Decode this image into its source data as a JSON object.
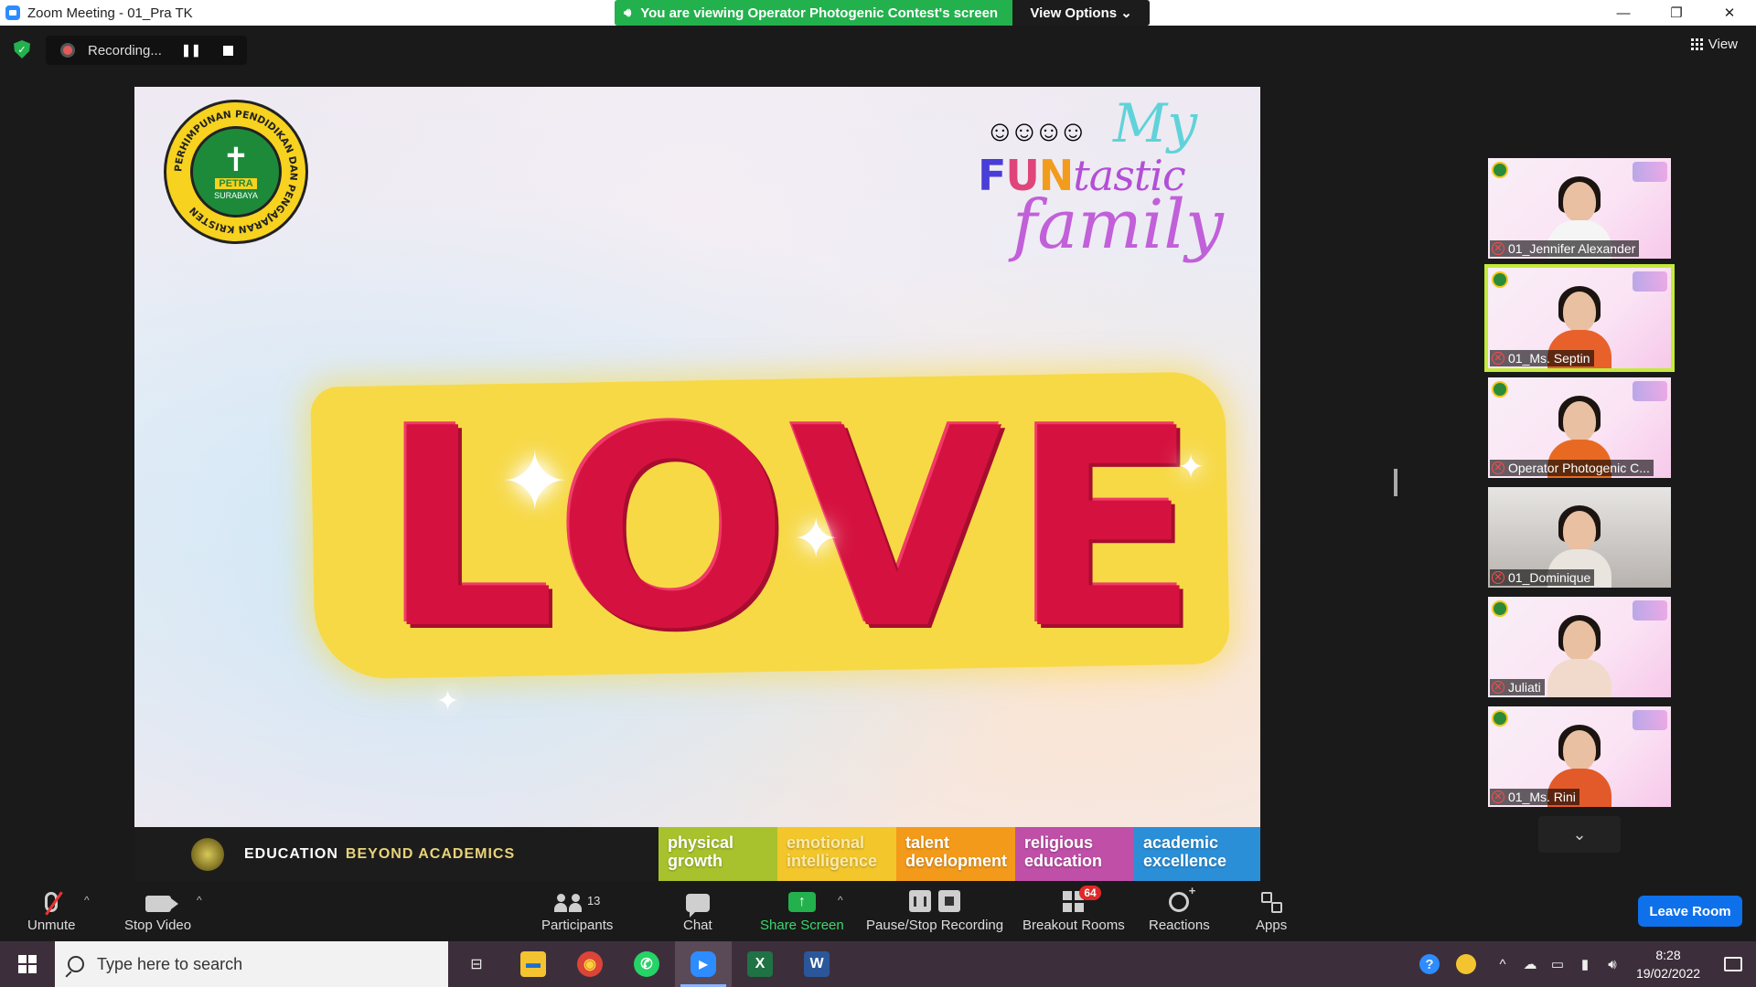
{
  "window": {
    "title": "Zoom Meeting - 01_Pra TK",
    "minimize": "—",
    "restore": "❐",
    "close": "✕"
  },
  "share_banner": {
    "viewing_text": "You are viewing Operator Photogenic Contest's screen",
    "view_options": "View Options ⌄"
  },
  "recording": {
    "status": "Recording...",
    "pause_glyph": "❚❚"
  },
  "view_button": {
    "label": "View"
  },
  "shared_slide": {
    "seal": {
      "name": "PETRA",
      "city": "SURABAYA",
      "ring_text": "PERHIMPUNAN PENDIDIKAN DAN PENGAJARAN KRISTEN"
    },
    "logo": {
      "my": "My",
      "fun": [
        "F",
        "U",
        "N"
      ],
      "tastic": "tastic",
      "family": "family"
    },
    "main_word": "LOVE",
    "footer": {
      "edu_part1": "EDUCATION",
      "edu_part2": "BEYOND ACADEMICS",
      "tiles": [
        {
          "line1": "physical",
          "line2": "growth",
          "color": "#a7c22c"
        },
        {
          "line1": "emotional",
          "line2": "intelligence",
          "color": "#f3c62b"
        },
        {
          "line1": "talent",
          "line2": "development",
          "color": "#f39a1b"
        },
        {
          "line1": "religious",
          "line2": "education",
          "color": "#c04fa8"
        },
        {
          "line1": "academic",
          "line2": "excellence",
          "color": "#2b8fd8"
        }
      ]
    }
  },
  "participants": [
    {
      "name": "01_Jennifer Alexander",
      "type": "slide",
      "body_color": "#f5f5f5",
      "active": false
    },
    {
      "name": "01_Ms. Septin",
      "type": "slide",
      "body_color": "#e8612b",
      "active": true
    },
    {
      "name": "Operator Photogenic C...",
      "type": "slide",
      "body_color": "#e86a22",
      "active": false
    },
    {
      "name": "01_Dominique",
      "type": "cam",
      "body_color": "#e9e4de",
      "active": false
    },
    {
      "name": "Juliati",
      "type": "slide",
      "body_color": "#f1dacc",
      "active": false
    },
    {
      "name": "01_Ms. Rini",
      "type": "slide",
      "body_color": "#e25a2a",
      "active": false
    }
  ],
  "strip_more": "⌄",
  "toolbar": {
    "unmute": "Unmute",
    "stop_video": "Stop Video",
    "participants": "Participants",
    "participants_count": "13",
    "chat": "Chat",
    "share_screen": "Share Screen",
    "pause_stop_recording": "Pause/Stop Recording",
    "breakout_rooms": "Breakout Rooms",
    "breakout_badge": "64",
    "reactions": "Reactions",
    "apps": "Apps",
    "leave_room": "Leave Room",
    "caret": "^"
  },
  "taskbar": {
    "search_placeholder": "Type here to search",
    "apps": [
      {
        "name": "task-view",
        "glyph": "⊟",
        "color": "transparent"
      },
      {
        "name": "file-explorer",
        "glyph": "▬",
        "color": "#f4c430"
      },
      {
        "name": "chrome",
        "glyph": "◉",
        "color": "#db4437"
      },
      {
        "name": "whatsapp",
        "glyph": "✆",
        "color": "#25d366"
      },
      {
        "name": "zoom",
        "glyph": "▶",
        "color": "#2d8cff"
      },
      {
        "name": "excel",
        "glyph": "X",
        "color": "#1f7244"
      },
      {
        "name": "word",
        "glyph": "W",
        "color": "#2b579a"
      }
    ],
    "clock_time": "8:28",
    "clock_date": "19/02/2022"
  }
}
